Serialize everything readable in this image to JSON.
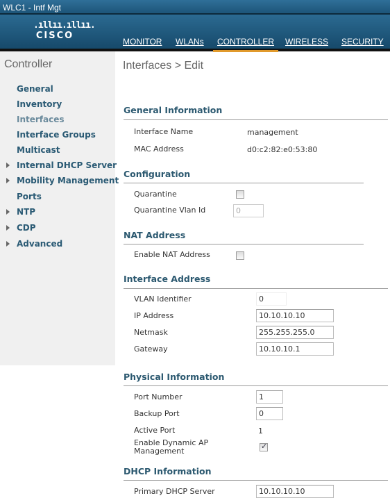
{
  "window": {
    "title": "WLC1 -  Intf Mgt"
  },
  "brand": {
    "logo_bars": ".ıllıı.ıllıı.",
    "logo_text": "CISCO",
    "accent": "#e19a2c"
  },
  "nav": [
    {
      "label": "MONITOR"
    },
    {
      "label": "WLANs"
    },
    {
      "label": "CONTROLLER",
      "active": true
    },
    {
      "label": "WIRELESS"
    },
    {
      "label": "SECURITY"
    }
  ],
  "sidebar": {
    "title": "Controller",
    "items": [
      {
        "label": "General"
      },
      {
        "label": "Inventory"
      },
      {
        "label": "Interfaces",
        "current": true
      },
      {
        "label": "Interface Groups"
      },
      {
        "label": "Multicast"
      },
      {
        "label": "Internal DHCP Server",
        "expandable": true
      },
      {
        "label": "Mobility Management",
        "expandable": true
      },
      {
        "label": "Ports"
      },
      {
        "label": "NTP",
        "expandable": true
      },
      {
        "label": "CDP",
        "expandable": true
      },
      {
        "label": "Advanced",
        "expandable": true
      }
    ]
  },
  "page": {
    "title": "Interfaces > Edit"
  },
  "general": {
    "heading": "General Information",
    "name_label": "Interface Name",
    "name_value": "management",
    "mac_label": "MAC Address",
    "mac_value": "d0:c2:82:e0:53:80"
  },
  "config": {
    "heading": "Configuration",
    "quarantine_label": "Quarantine",
    "quarantine_checked": false,
    "qvlan_label": "Quarantine Vlan Id",
    "qvlan_value": "0"
  },
  "nat": {
    "heading": "NAT Address",
    "enable_label": "Enable NAT Address",
    "enable_checked": false
  },
  "iface": {
    "heading": "Interface Address",
    "vlan_label": "VLAN Identifier",
    "vlan_value": "0",
    "ip_label": "IP Address",
    "ip_value": "10.10.10.10",
    "mask_label": "Netmask",
    "mask_value": "255.255.255.0",
    "gw_label": "Gateway",
    "gw_value": "10.10.10.1"
  },
  "physical": {
    "heading": "Physical Information",
    "port_label": "Port Number",
    "port_value": "1",
    "backup_label": "Backup Port",
    "backup_value": "0",
    "active_label": "Active Port",
    "active_value": "1",
    "dyn_label": "Enable Dynamic AP Management",
    "dyn_checked": true
  },
  "dhcp": {
    "heading": "DHCP Information",
    "primary_label": "Primary DHCP Server",
    "primary_value": "10.10.10.10"
  }
}
